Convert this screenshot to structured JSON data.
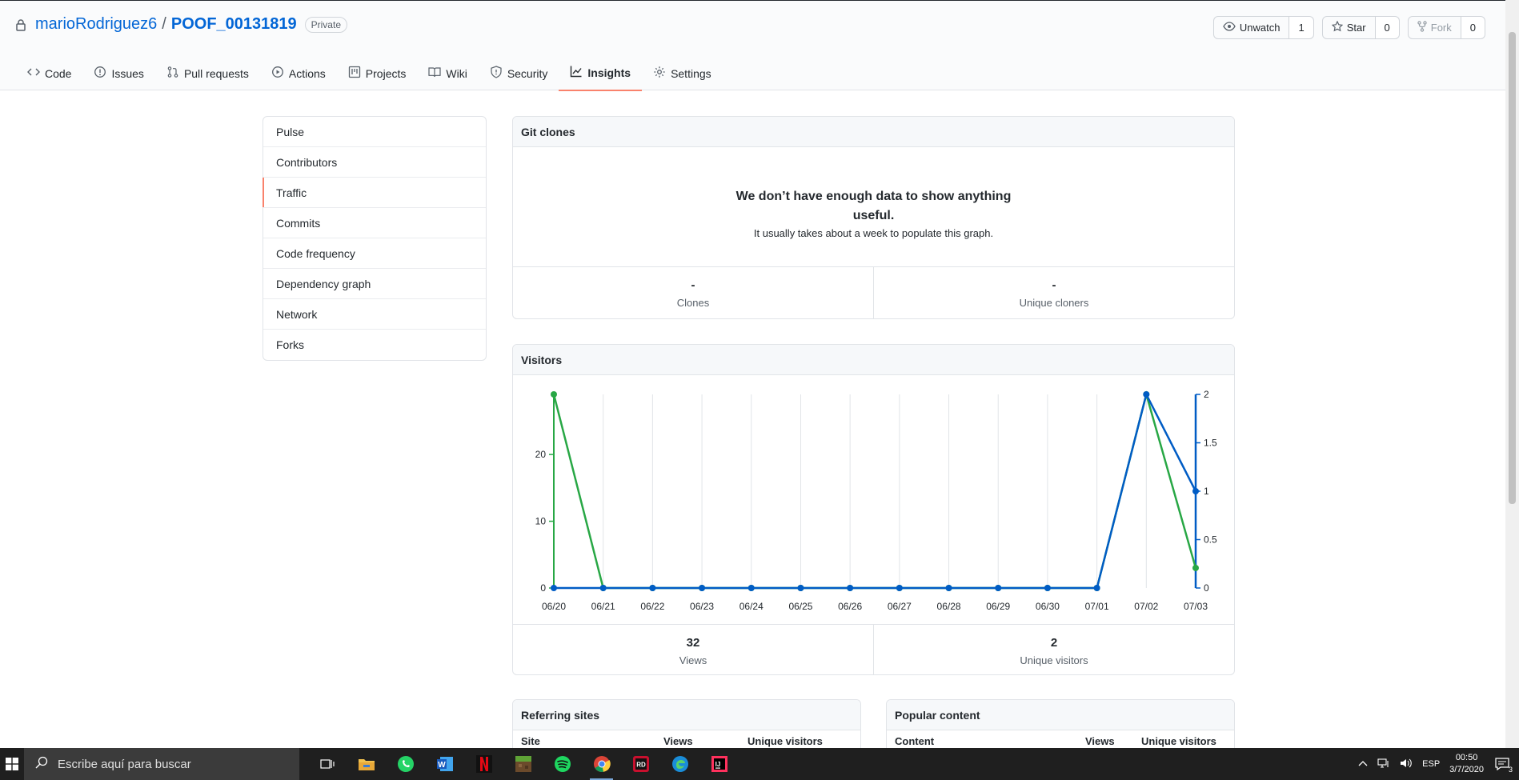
{
  "repo": {
    "owner": "marioRodriguez6",
    "separator": "/",
    "name": "POOF_00131819",
    "visibility": "Private"
  },
  "actions": {
    "watch_label": "Unwatch",
    "watch_count": "1",
    "star_label": "Star",
    "star_count": "0",
    "fork_label": "Fork",
    "fork_count": "0"
  },
  "tabs": [
    {
      "label": "Code",
      "icon": "code-icon"
    },
    {
      "label": "Issues",
      "icon": "issue-icon"
    },
    {
      "label": "Pull requests",
      "icon": "pull-request-icon"
    },
    {
      "label": "Actions",
      "icon": "play-icon"
    },
    {
      "label": "Projects",
      "icon": "project-icon"
    },
    {
      "label": "Wiki",
      "icon": "book-icon"
    },
    {
      "label": "Security",
      "icon": "shield-icon"
    },
    {
      "label": "Insights",
      "icon": "graph-icon",
      "selected": true
    },
    {
      "label": "Settings",
      "icon": "gear-icon"
    }
  ],
  "sidebar": {
    "items": [
      "Pulse",
      "Contributors",
      "Traffic",
      "Commits",
      "Code frequency",
      "Dependency graph",
      "Network",
      "Forks"
    ],
    "active": "Traffic"
  },
  "clones": {
    "title": "Git clones",
    "blank_title": "We don’t have enough data to show anything useful.",
    "blank_sub": "It usually takes about a week to populate this graph.",
    "clones_value": "-",
    "clones_label": "Clones",
    "unique_value": "-",
    "unique_label": "Unique cloners"
  },
  "visitors": {
    "title": "Visitors",
    "views_value": "32",
    "views_label": "Views",
    "unique_value": "2",
    "unique_label": "Unique visitors"
  },
  "chart_data": {
    "type": "line",
    "x": [
      "06/20",
      "06/21",
      "06/22",
      "06/23",
      "06/24",
      "06/25",
      "06/26",
      "06/27",
      "06/28",
      "06/29",
      "06/30",
      "07/01",
      "07/02",
      "07/03"
    ],
    "series": [
      {
        "axis": "left",
        "color": "#28a745",
        "values": [
          29,
          0,
          0,
          0,
          0,
          0,
          0,
          0,
          0,
          0,
          0,
          0,
          29,
          3
        ]
      },
      {
        "axis": "right",
        "color": "#005cc5",
        "values": [
          0,
          0,
          0,
          0,
          0,
          0,
          0,
          0,
          0,
          0,
          0,
          0,
          2,
          1
        ]
      }
    ],
    "left_ticks": [
      "0",
      "10",
      "20"
    ],
    "right_ticks": [
      "0",
      "0.5",
      "1",
      "1.5",
      "2"
    ],
    "ylim_left": [
      0,
      29
    ],
    "ylim_right": [
      0,
      2
    ],
    "grid": "vertical"
  },
  "referring": {
    "title": "Referring sites",
    "columns": [
      "Site",
      "Views",
      "Unique visitors"
    ]
  },
  "popular": {
    "title": "Popular content",
    "columns": [
      "Content",
      "Views",
      "Unique visitors"
    ]
  },
  "taskbar": {
    "search_placeholder": "Escribe aquí para buscar",
    "apps": [
      "task-view-icon",
      "file-explorer-icon",
      "whatsapp-icon",
      "word-icon",
      "netflix-icon",
      "minecraft-icon",
      "spotify-icon",
      "chrome-icon",
      "rd-icon",
      "edge-icon",
      "intellij-icon"
    ],
    "active_app": "chrome-icon",
    "language": "ESP",
    "time": "00:50",
    "date": "3/7/2020",
    "notifications": "3"
  }
}
